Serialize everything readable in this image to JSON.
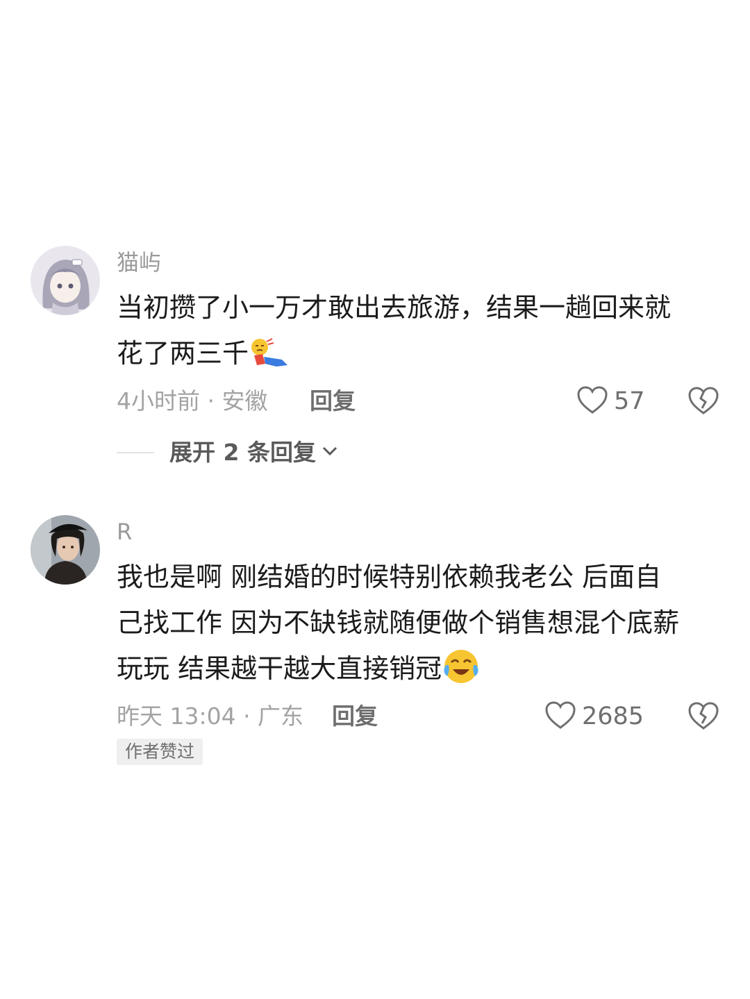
{
  "comments": [
    {
      "username": "猫屿",
      "avatar": "anime-girl-avatar",
      "line1": "当初攒了小一万才敢出去旅游，结果一趟回来就",
      "line2": "花了两三千",
      "emoji": "lying-flat-emoji",
      "time_location": "4小时前 · 安徽",
      "reply_label": "回复",
      "likes": "57",
      "expand_label": "展开 2 条回复"
    },
    {
      "username": "R",
      "avatar": "woman-photo-avatar",
      "line1": "我也是啊 刚结婚的时候特别依赖我老公 后面自",
      "line2": "己找工作 因为不缺钱就随便做个销售想混个底薪",
      "line3": "玩玩 结果越干越大直接销冠",
      "emoji": "crying-laughing-emoji",
      "time_location": "昨天 13:04 · 广东",
      "reply_label": "回复",
      "likes": "2685",
      "badge": "作者赞过"
    }
  ],
  "colors": {
    "text": "#1b1b1b",
    "meta": "#a3a3a3",
    "action": "#6e6e6e"
  }
}
